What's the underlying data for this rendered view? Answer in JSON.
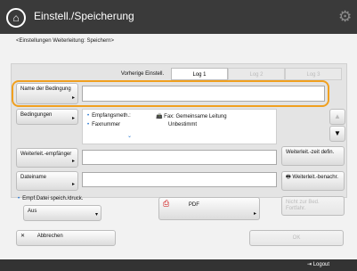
{
  "header": {
    "title": "Einstell./Speicherung"
  },
  "breadcrumb": "<Einstellungen Weiterleitung: Speichern>",
  "tabs": {
    "label": "Vorherige Einstell.",
    "items": [
      "Log 1",
      "Log 2",
      "Log 3"
    ]
  },
  "buttons": {
    "condition_name": "Name der Bedingung",
    "conditions": "Bedingungen",
    "recipient": "Weiterleit.-empfänger",
    "filename": "Dateiname",
    "fwd_time": "Weiterleit.-zeit defin.",
    "fwd_notify": "Weiterleit.-benachr.",
    "no_fwd": "Nicht zur Bed. Fortfahr.",
    "pdf": "PDF",
    "cancel": "Abbrechen",
    "start": "OK"
  },
  "conditions_box": {
    "left": [
      "Empfangsmeth.:",
      "Faxnummer"
    ],
    "right": [
      "Fax: Gemeinsame Leitung",
      "Unbestimmt"
    ]
  },
  "file_print": {
    "label": "Empf.Datei speich./druck.",
    "value": "Aus"
  },
  "footer": {
    "logout": "Logout"
  }
}
